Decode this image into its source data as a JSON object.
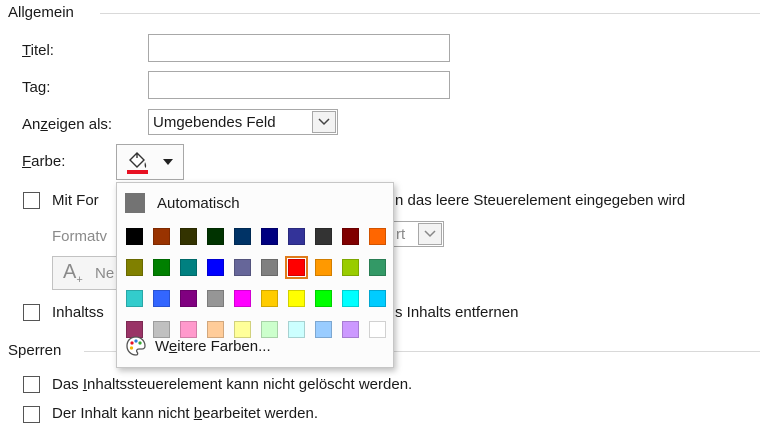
{
  "general": {
    "section_title": "Allgemein",
    "title_label_key": "T",
    "title_label_rest": "itel:",
    "title_value": "",
    "tag_label_pre": "Ta",
    "tag_label_key": "g",
    "tag_label_post": ":",
    "tag_value": "",
    "show_as_pre": "An",
    "show_as_key": "z",
    "show_as_post": "eigen als:",
    "show_as_value": "Umgebendes Feld",
    "color_label_key": "F",
    "color_label_rest": "arbe:",
    "format_checkbox_left": "Mit For",
    "format_checkbox_right": "n das leere Steuerelement eingegeben wird",
    "format_label_visible": "Formatv",
    "format_combo_visible": "rt",
    "add_button_visible": "Ne",
    "remove_checkbox_left": "Inhaltss",
    "remove_checkbox_right": "s Inhalts entfernen"
  },
  "color_menu": {
    "automatic_label": "Automatisch",
    "more_colors_pre": "W",
    "more_colors_key": "e",
    "more_colors_post": "itere Farben...",
    "selected": "#ff0000",
    "rows": [
      [
        "#000000",
        "#993300",
        "#333300",
        "#003300",
        "#003366",
        "#000080",
        "#333399",
        "#333333",
        "#800000",
        "#ff6600"
      ],
      [
        "#808000",
        "#008000",
        "#008080",
        "#0000ff",
        "#666699",
        "#808080",
        "#ff0000",
        "#ff9900",
        "#99cc00",
        "#339966"
      ],
      [
        "#33cccc",
        "#3366ff",
        "#800080",
        "#969696",
        "#ff00ff",
        "#ffcc00",
        "#ffff00",
        "#00ff00",
        "#00ffff",
        "#00ccff"
      ],
      [
        "#993366",
        "#c0c0c0",
        "#ff99cc",
        "#ffcc99",
        "#ffff99",
        "#ccffcc",
        "#ccffff",
        "#99ccff",
        "#cc99ff",
        "#ffffff"
      ]
    ]
  },
  "lock": {
    "section_title": "Sperren",
    "cannot_delete_pre": "Das ",
    "cannot_delete_key": "I",
    "cannot_delete_post": "nhaltssteuerelement kann nicht gelöscht werden.",
    "cannot_edit_pre": "Der Inhalt kann nicht ",
    "cannot_edit_key": "b",
    "cannot_edit_post": "earbeitet werden."
  },
  "colors": {
    "accent_underline": "#e81123",
    "selection_outline": "#e07b1a"
  }
}
